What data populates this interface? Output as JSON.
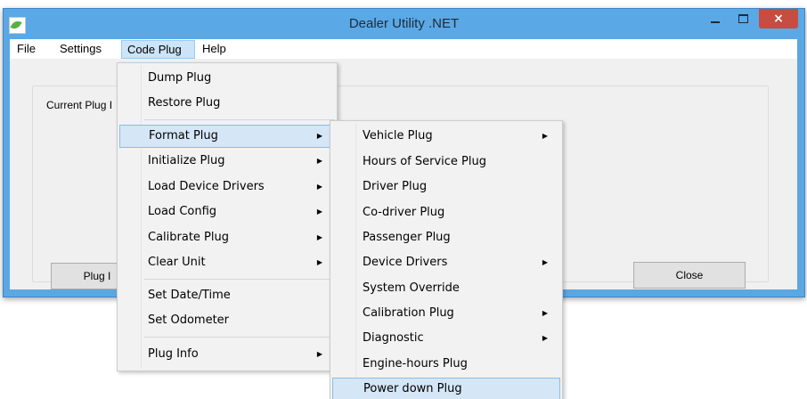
{
  "window": {
    "title": "Dealer Utility .NET",
    "minimize": "–",
    "maximize": "□",
    "close": "×"
  },
  "menubar": {
    "items": [
      {
        "label": "File"
      },
      {
        "label": "Settings"
      },
      {
        "label": "Code Plug",
        "state": "open"
      },
      {
        "label": "Help"
      }
    ]
  },
  "main": {
    "group_label": "Current Plug I",
    "plug_info_button": "Plug I",
    "close_button": "Close"
  },
  "code_plug_menu": {
    "items": [
      {
        "label": "Dump Plug"
      },
      {
        "label": "Restore Plug"
      },
      {
        "label": "Format Plug",
        "submenu": true,
        "highlighted": true
      },
      {
        "label": "Initialize Plug",
        "submenu": true
      },
      {
        "label": "Load Device Drivers",
        "submenu": true
      },
      {
        "label": "Load Config",
        "submenu": true
      },
      {
        "label": "Calibrate Plug",
        "submenu": true
      },
      {
        "label": "Clear Unit",
        "submenu": true
      },
      {
        "label": "Set Date/Time"
      },
      {
        "label": "Set Odometer"
      },
      {
        "label": "Plug Info",
        "submenu": true
      }
    ]
  },
  "format_plug_submenu": {
    "items": [
      {
        "label": "Vehicle Plug",
        "submenu": true
      },
      {
        "label": "Hours of Service Plug"
      },
      {
        "label": "Driver Plug"
      },
      {
        "label": "Co-driver Plug"
      },
      {
        "label": "Passenger Plug"
      },
      {
        "label": "Device Drivers",
        "submenu": true
      },
      {
        "label": "System Override"
      },
      {
        "label": "Calibration Plug",
        "submenu": true
      },
      {
        "label": "Diagnostic",
        "submenu": true
      },
      {
        "label": "Engine-hours Plug"
      },
      {
        "label": "Power down Plug",
        "highlighted": true
      }
    ]
  },
  "icons": {
    "submenu_arrow": "▶",
    "app_icon": "leaf-icon"
  },
  "colors": {
    "titlebar": "#5ba8e6",
    "close_button": "#c74c41",
    "menu_highlight": "#d5e6f7",
    "menu_highlight_border": "#8fbbe6"
  }
}
